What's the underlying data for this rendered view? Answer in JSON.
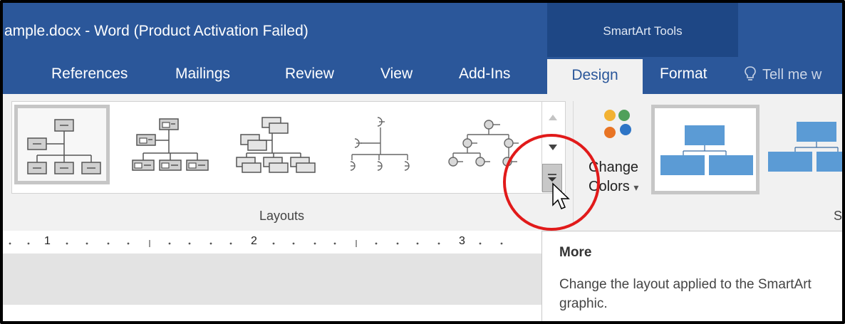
{
  "title_bar": {
    "document_title": "ample.docx - Word (Product Activation Failed)",
    "context_tools": "SmartArt Tools"
  },
  "tabs": [
    {
      "label": "References",
      "active": false
    },
    {
      "label": "Mailings",
      "active": false
    },
    {
      "label": "Review",
      "active": false
    },
    {
      "label": "View",
      "active": false
    },
    {
      "label": "Add-Ins",
      "active": false
    },
    {
      "label": "Design",
      "active": true
    },
    {
      "label": "Format",
      "active": false
    }
  ],
  "tell_me": {
    "label": "Tell me w",
    "icon": "lightbulb-icon"
  },
  "ribbon": {
    "layouts_group_label": "Layouts",
    "layouts": [
      {
        "name": "org-chart",
        "selected": true
      },
      {
        "name": "name-and-title-org-chart",
        "selected": false
      },
      {
        "name": "half-circle-org-chart",
        "selected": false
      },
      {
        "name": "circle-picture-hierarchy",
        "selected": false
      },
      {
        "name": "labeled-hierarchy",
        "selected": false
      }
    ],
    "scroll_up_icon": "triangle-up-icon",
    "scroll_down_icon": "triangle-down-icon",
    "more_icon": "more-gallery-icon",
    "change_colors": {
      "line1": "Change",
      "line2": "Colors",
      "arrow": "▾",
      "dot_colors": [
        "#f2b233",
        "#50a05a",
        "#e87424",
        "#2e75c6"
      ]
    },
    "styles_group_label_partial": "S",
    "accent_blue": "#5b9bd5"
  },
  "ruler": {
    "marks": [
      "1",
      "2",
      "3"
    ]
  },
  "tooltip": {
    "title": "More",
    "description": "Change the layout applied to the SmartArt graphic."
  },
  "colors": {
    "title_bar": "#2b579a",
    "context_band": "#1e4785",
    "annotation_circle": "#e11a1a"
  }
}
